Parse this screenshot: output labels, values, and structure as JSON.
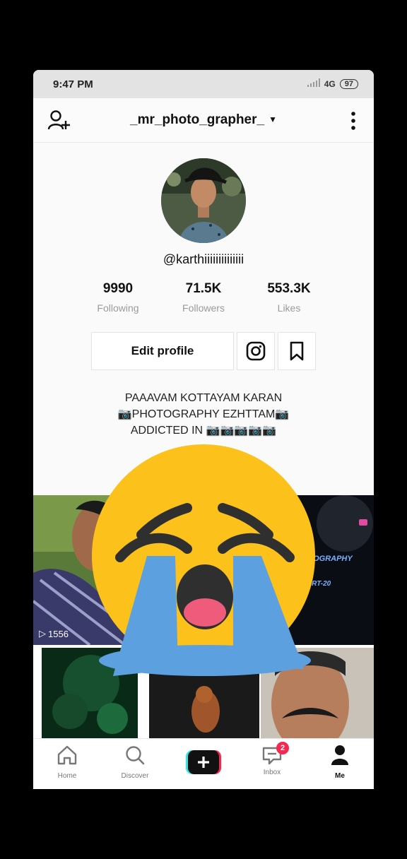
{
  "status_bar": {
    "time": "9:47 PM",
    "network": "4G",
    "battery": "97"
  },
  "header": {
    "username": "_mr_photo_grapher_"
  },
  "profile": {
    "handle": "@karthiiiiiiiiiiiiii",
    "stats": [
      {
        "value": "9990",
        "label": "Following"
      },
      {
        "value": "71.5K",
        "label": "Followers"
      },
      {
        "value": "553.3K",
        "label": "Likes"
      }
    ],
    "edit_label": "Edit profile",
    "bio": [
      "PAAAVAM KOTTAYAM KARAN",
      "📷PHOTOGRAPHY EZHTTAM📷",
      "ADDICTED IN 📷📷📷📷📷"
    ]
  },
  "videos": [
    {
      "views": "1556"
    },
    {
      "overlay_line1": "OTOGRAPHY",
      "overlay_line2": "PART-20"
    }
  ],
  "nav": {
    "home": "Home",
    "discover": "Discover",
    "inbox": "Inbox",
    "inbox_badge": "2",
    "me": "Me"
  }
}
